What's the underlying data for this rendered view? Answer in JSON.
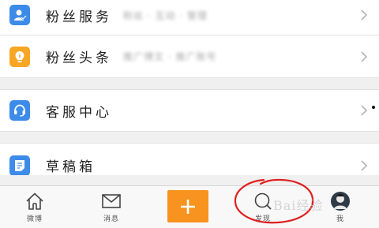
{
  "menu": {
    "group1": [
      {
        "label": "粉丝服务",
        "sub": "粉丝 · 互动 · 管理"
      },
      {
        "label": "粉丝头条",
        "sub": "推广博文 · 推广账号"
      }
    ],
    "group2": [
      {
        "label": "客服中心"
      }
    ],
    "group3": [
      {
        "label": "草稿箱"
      }
    ]
  },
  "tabbar": {
    "home": "微博",
    "messages": "消息",
    "discover": "发现",
    "me": "我"
  },
  "watermark": "Bai经验",
  "colors": {
    "accent": "#f7931e",
    "blue_icon": "#3d8be9",
    "orange_icon": "#f6a623",
    "annotation": "#e02020"
  }
}
